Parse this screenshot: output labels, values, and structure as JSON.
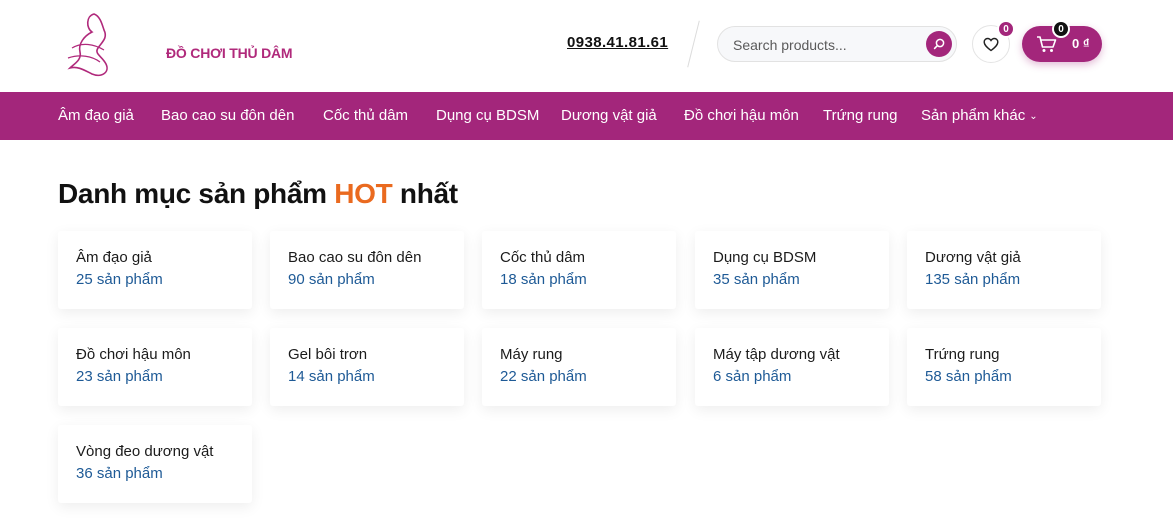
{
  "header": {
    "logo_text": "ĐỒ CHƠI THỦ DÂM",
    "phone": "0938.41.81.61",
    "search_placeholder": "Search products...",
    "wishlist_count": "0",
    "cart_count": "0",
    "cart_total": "0 ₫"
  },
  "nav": {
    "items": [
      "Âm đạo giả",
      "Bao cao su đôn dên",
      "Cốc thủ dâm",
      "Dụng cụ BDSM",
      "Dương vật giả",
      "Đồ chơi hậu môn",
      "Trứng rung",
      "Sản phẩm khác"
    ]
  },
  "main": {
    "heading_before": "Danh mục sản phẩm ",
    "heading_hot": "HOT",
    "heading_after": " nhất",
    "categories": [
      {
        "name": "Âm đạo giả",
        "count": "25 sản phẩm"
      },
      {
        "name": "Bao cao su đôn dên",
        "count": "90 sản phẩm"
      },
      {
        "name": "Cốc thủ dâm",
        "count": "18 sản phẩm"
      },
      {
        "name": "Dụng cụ BDSM",
        "count": "35 sản phẩm"
      },
      {
        "name": "Dương vật giả",
        "count": "135 sản phẩm"
      },
      {
        "name": "Đồ chơi hậu môn",
        "count": "23 sản phẩm"
      },
      {
        "name": "Gel bôi trơn",
        "count": "14 sản phẩm"
      },
      {
        "name": "Máy rung",
        "count": "22 sản phẩm"
      },
      {
        "name": "Máy tập dương vật",
        "count": "6 sản phẩm"
      },
      {
        "name": "Trứng rung",
        "count": "58 sản phẩm"
      },
      {
        "name": "Vòng đeo dương vật",
        "count": "36 sản phẩm"
      }
    ]
  },
  "colors": {
    "brand": "#a3267b",
    "hot": "#ea6a1f",
    "count_text": "#1e5a96"
  }
}
